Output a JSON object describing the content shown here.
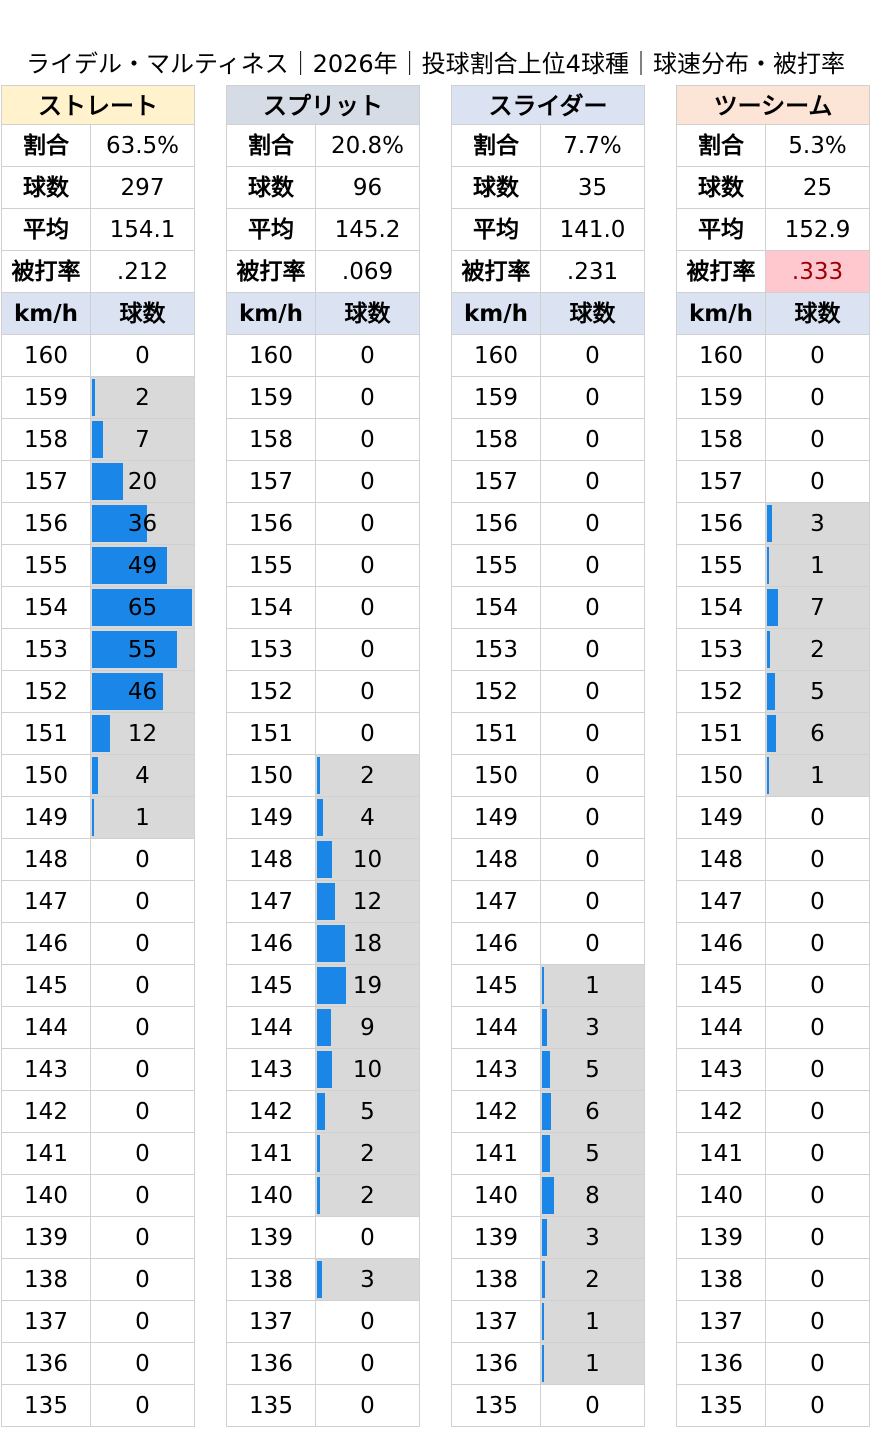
{
  "title": "ライデル・マルティネス｜2026年｜投球割合上位4球種｜球速分布・被打率",
  "labels": {
    "ratio": "割合",
    "count": "球数",
    "avg": "平均",
    "ba": "被打率",
    "speed_col": "km/h",
    "count_col": "球数"
  },
  "colors": {
    "bar": "#1a86e8",
    "bar_bg": "#d9d9d9",
    "highlight_bg": "#ffc7ce",
    "highlight_text": "#9c0006"
  },
  "chart_data": {
    "type": "table",
    "speeds": [
      160,
      159,
      158,
      157,
      156,
      155,
      154,
      153,
      152,
      151,
      150,
      149,
      148,
      147,
      146,
      145,
      144,
      143,
      142,
      141,
      140,
      139,
      138,
      137,
      136,
      135
    ],
    "bar_max": 65,
    "pitches": [
      {
        "name": "ストレート",
        "header_color": "#fff2cc",
        "ratio": "63.5%",
        "count": "297",
        "avg": "154.1",
        "ba": ".212",
        "ba_highlight": false,
        "counts": [
          0,
          2,
          7,
          20,
          36,
          49,
          65,
          55,
          46,
          12,
          4,
          1,
          0,
          0,
          0,
          0,
          0,
          0,
          0,
          0,
          0,
          0,
          0,
          0,
          0,
          0
        ]
      },
      {
        "name": "スプリット",
        "header_color": "#d6dce5",
        "ratio": "20.8%",
        "count": "96",
        "avg": "145.2",
        "ba": ".069",
        "ba_highlight": false,
        "counts": [
          0,
          0,
          0,
          0,
          0,
          0,
          0,
          0,
          0,
          0,
          2,
          4,
          10,
          12,
          18,
          19,
          9,
          10,
          5,
          2,
          2,
          0,
          3,
          0,
          0,
          0
        ]
      },
      {
        "name": "スライダー",
        "header_color": "#dbe3f3",
        "ratio": "7.7%",
        "count": "35",
        "avg": "141.0",
        "ba": ".231",
        "ba_highlight": false,
        "counts": [
          0,
          0,
          0,
          0,
          0,
          0,
          0,
          0,
          0,
          0,
          0,
          0,
          0,
          0,
          0,
          1,
          3,
          5,
          6,
          5,
          8,
          3,
          2,
          1,
          1,
          0
        ]
      },
      {
        "name": "ツーシーム",
        "header_color": "#fce4d6",
        "ratio": "5.3%",
        "count": "25",
        "avg": "152.9",
        "ba": ".333",
        "ba_highlight": true,
        "counts": [
          0,
          0,
          0,
          0,
          3,
          1,
          7,
          2,
          5,
          6,
          1,
          0,
          0,
          0,
          0,
          0,
          0,
          0,
          0,
          0,
          0,
          0,
          0,
          0,
          0,
          0
        ]
      }
    ]
  }
}
